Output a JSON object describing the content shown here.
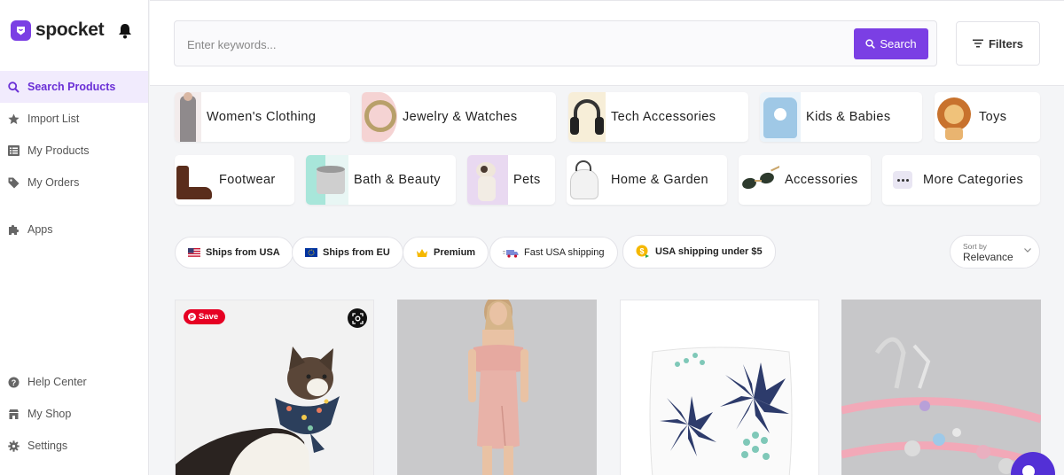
{
  "brand": {
    "name": "spocket",
    "accent": "#7b3fe4"
  },
  "sidebar": {
    "items": [
      {
        "label": "Search Products",
        "icon": "search-icon"
      },
      {
        "label": "Import List",
        "icon": "star-icon"
      },
      {
        "label": "My Products",
        "icon": "list-icon"
      },
      {
        "label": "My Orders",
        "icon": "tag-icon"
      },
      {
        "label": "Apps",
        "icon": "puzzle-icon"
      },
      {
        "label": "Help Center",
        "icon": "help-icon"
      },
      {
        "label": "My Shop",
        "icon": "shop-icon"
      },
      {
        "label": "Settings",
        "icon": "gear-icon"
      }
    ]
  },
  "search": {
    "placeholder": "Enter keywords...",
    "button_label": "Search",
    "filters_label": "Filters"
  },
  "categories": [
    {
      "label": "Women's Clothing"
    },
    {
      "label": "Jewelry & Watches"
    },
    {
      "label": "Tech Accessories"
    },
    {
      "label": "Kids & Babies"
    },
    {
      "label": "Toys"
    },
    {
      "label": "Footwear"
    },
    {
      "label": "Bath & Beauty"
    },
    {
      "label": "Pets"
    },
    {
      "label": "Home & Garden"
    },
    {
      "label": "Accessories"
    },
    {
      "label": "More Categories"
    }
  ],
  "chips": [
    {
      "label": "Ships from USA",
      "icon": "us-flag-icon"
    },
    {
      "label": "Ships from EU",
      "icon": "eu-flag-icon"
    },
    {
      "label": "Premium",
      "icon": "crown-icon"
    },
    {
      "label": "Fast USA shipping",
      "icon": "fast-shipping-icon"
    },
    {
      "label": "USA shipping under $5",
      "icon": "dollar-coin-icon"
    }
  ],
  "sort": {
    "caption": "Sort by",
    "value": "Relevance"
  },
  "products": {
    "pin_save_label": "Save"
  }
}
